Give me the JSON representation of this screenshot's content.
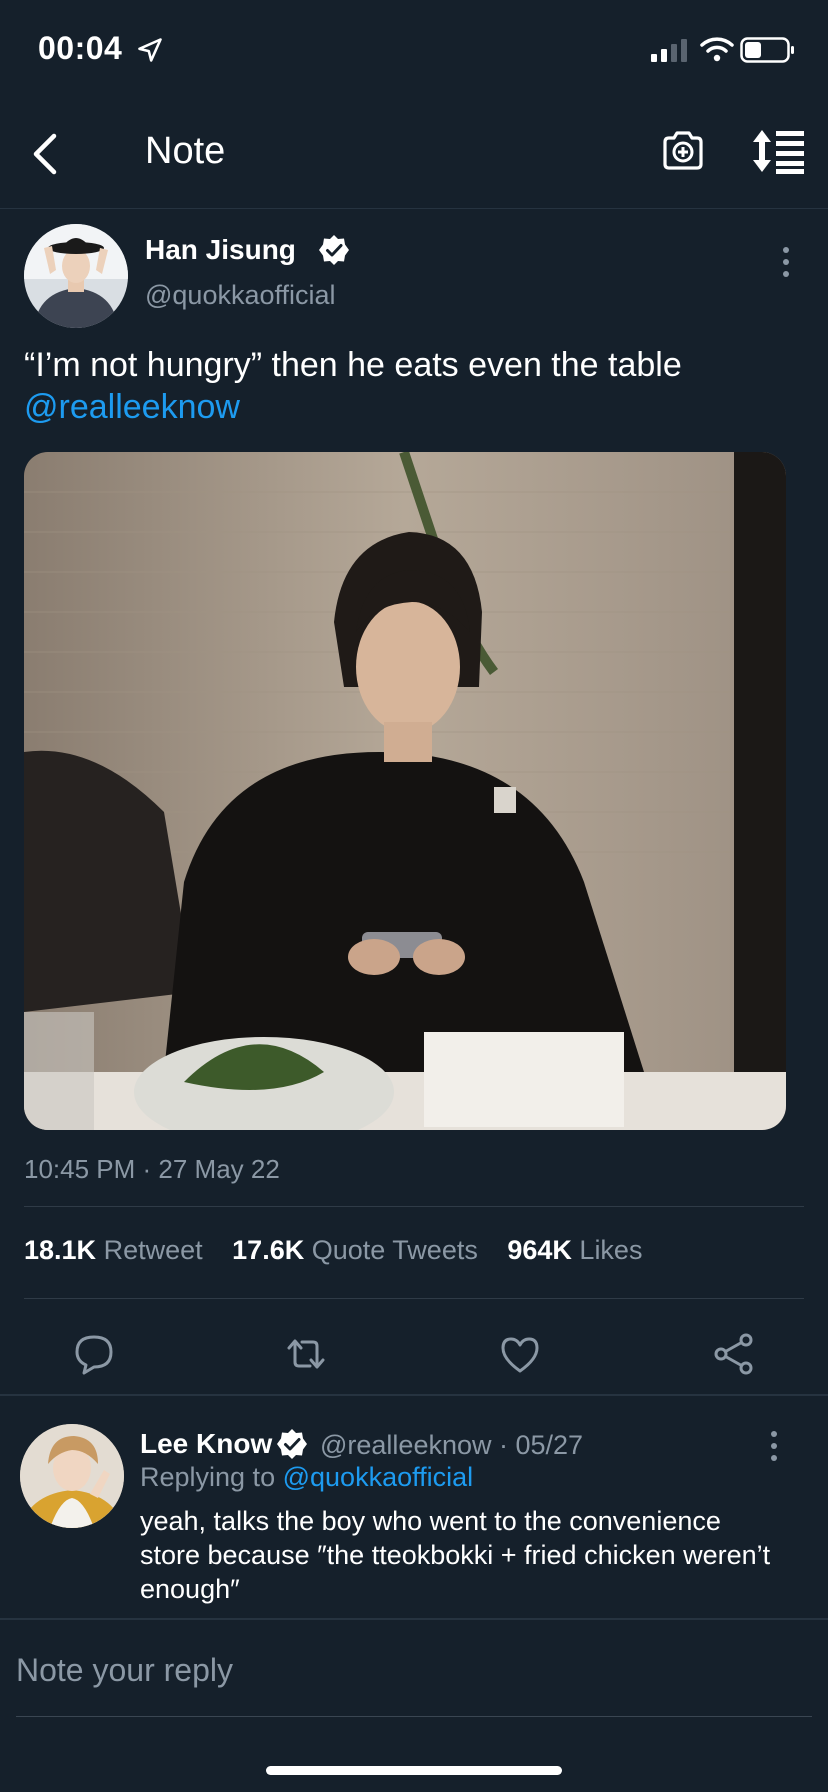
{
  "status_bar": {
    "time": "00:04"
  },
  "nav": {
    "title": "Note"
  },
  "tweet": {
    "author_name": "Han Jisung",
    "author_handle": "@quokkaofficial",
    "text": "“I’m not hungry” then he eats even the table",
    "mention": "@realleeknow",
    "timestamp": "10:45 PM · 27 May 22",
    "stats": {
      "retweets_count": "18.1K",
      "retweets_label": "Retweet",
      "quotes_count": "17.6K",
      "quotes_label": "Quote Tweets",
      "likes_count": "964K",
      "likes_label": "Likes"
    }
  },
  "reply": {
    "author_name": "Lee Know",
    "meta": "@realleeknow · 05/27",
    "replying_prefix": "Replying to",
    "replying_to": "@quokkaofficial",
    "text": "yeah, talks the boy who went to the convenience store because ″the tteokbokki + fried chicken weren’t enough″"
  },
  "composer": {
    "placeholder": "Note your reply"
  },
  "colors": {
    "background": "#15202b",
    "accent": "#1d9bf0",
    "muted": "#8b98a5"
  }
}
